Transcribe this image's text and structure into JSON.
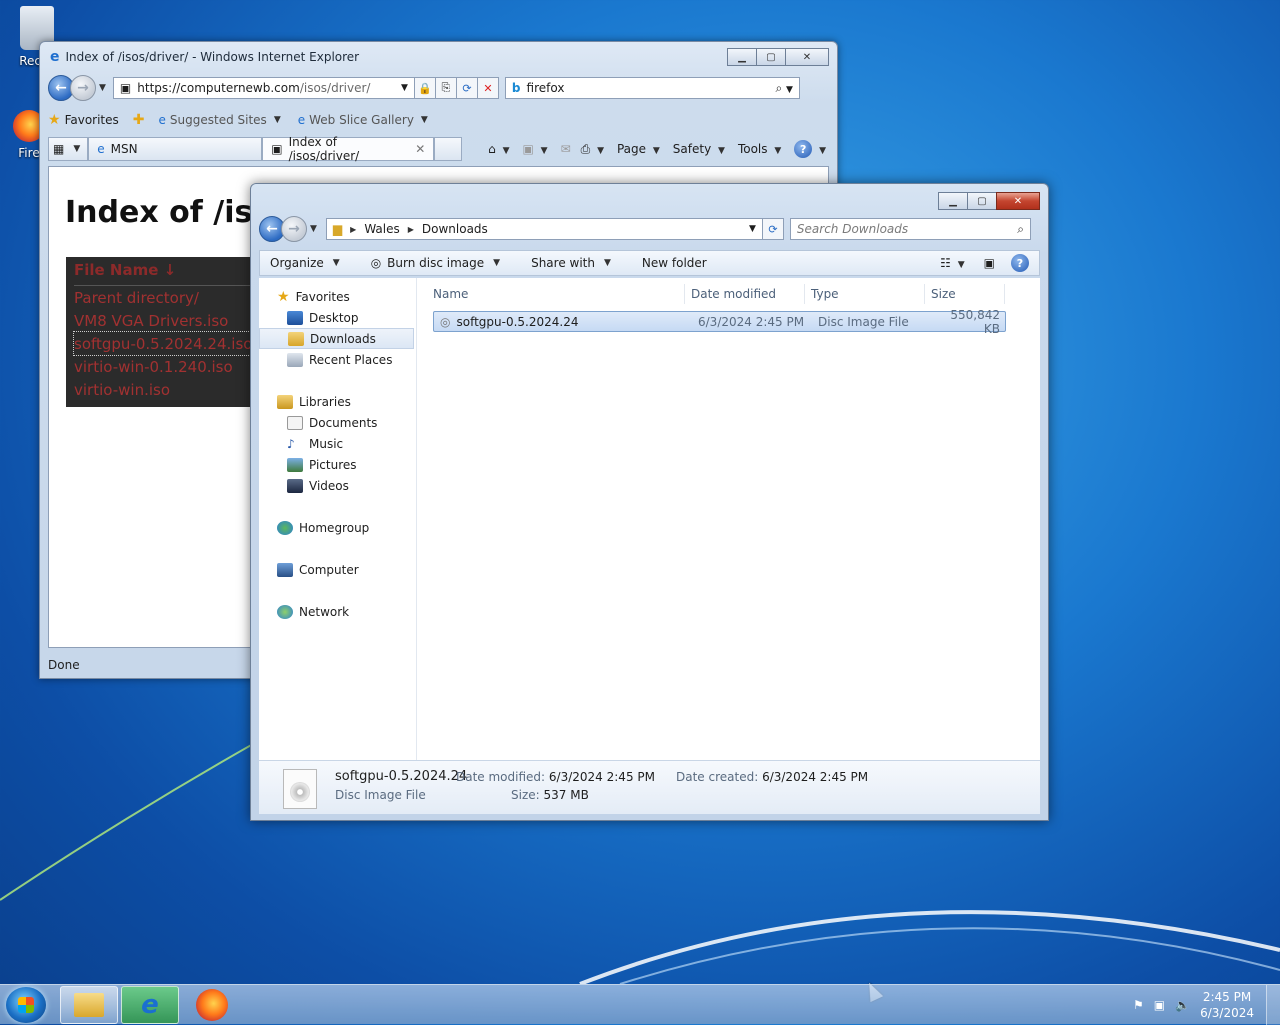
{
  "desktop": {
    "icons": [
      {
        "label": "Recyc",
        "icon": "recycle-bin-icon"
      },
      {
        "label": "Fire",
        "icon": "firefox-icon"
      }
    ]
  },
  "ie": {
    "title": "Index of /isos/driver/ - Windows Internet Explorer",
    "url_host": "https://computernewb.com",
    "url_path": "/isos/driver/",
    "search_value": "firefox",
    "favorites_label": "Favorites",
    "suggested_sites": "Suggested Sites",
    "web_slice_gallery": "Web Slice Gallery",
    "tabs": [
      "MSN",
      "Index of /isos/driver/"
    ],
    "commands": {
      "page": "Page",
      "safety": "Safety",
      "tools": "Tools"
    },
    "heading": "Index of /iso",
    "listing_header": "File Name  ↓",
    "listing": [
      "Parent directory/",
      "VM8 VGA Drivers.iso",
      "softgpu-0.5.2024.24.iso",
      "virtio-win-0.1.240.iso",
      "virtio-win.iso"
    ],
    "status": "Done"
  },
  "explorer": {
    "breadcrumb": [
      "Wales",
      "Downloads"
    ],
    "search_placeholder": "Search Downloads",
    "toolbar": {
      "organize": "Organize",
      "burn": "Burn disc image",
      "share": "Share with",
      "new_folder": "New folder"
    },
    "nav": {
      "favorites": "Favorites",
      "desktop": "Desktop",
      "downloads": "Downloads",
      "recent": "Recent Places",
      "libraries": "Libraries",
      "documents": "Documents",
      "music": "Music",
      "pictures": "Pictures",
      "videos": "Videos",
      "homegroup": "Homegroup",
      "computer": "Computer",
      "network": "Network"
    },
    "columns": {
      "name": "Name",
      "date": "Date modified",
      "type": "Type",
      "size": "Size"
    },
    "files": [
      {
        "name": "softgpu-0.5.2024.24",
        "date": "6/3/2024 2:45 PM",
        "type": "Disc Image File",
        "size": "550,842 KB"
      }
    ],
    "details": {
      "name": "softgpu-0.5.2024.24",
      "kind": "Disc Image File",
      "modified_label": "Date modified:",
      "modified": "6/3/2024 2:45 PM",
      "created_label": "Date created:",
      "created": "6/3/2024 2:45 PM",
      "size_label": "Size:",
      "size": "537 MB"
    }
  },
  "taskbar": {
    "time": "2:45 PM",
    "date": "6/3/2024"
  }
}
